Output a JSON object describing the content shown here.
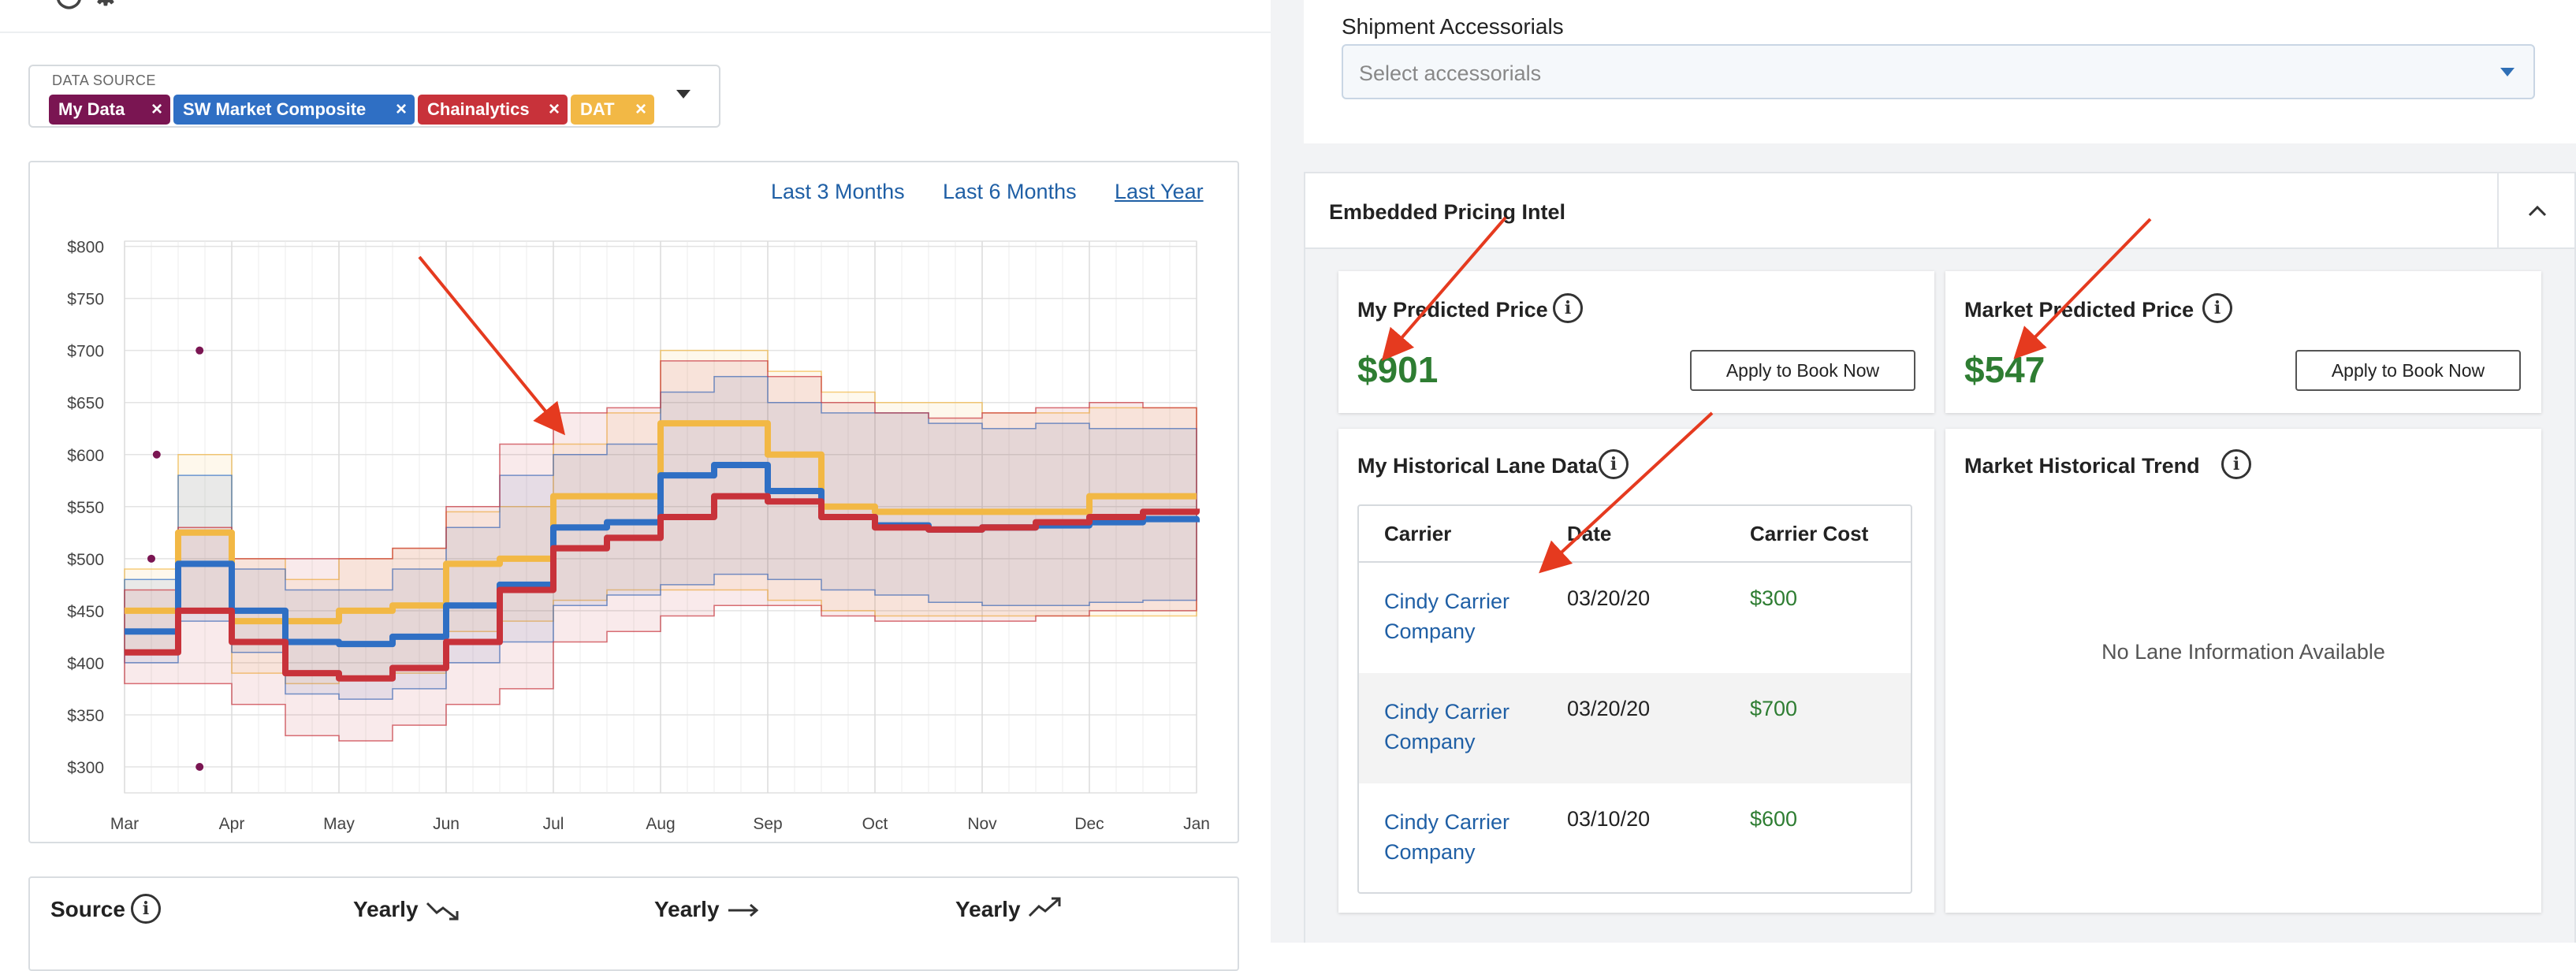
{
  "left": {
    "data_source": {
      "label": "DATA SOURCE",
      "chips": [
        {
          "label": "My Data",
          "remove": "×",
          "color": "#7a1552"
        },
        {
          "label": "SW Market Composite",
          "remove": "×",
          "color": "#2f6fc4"
        },
        {
          "label": "Chainalytics",
          "remove": "×",
          "color": "#c8323a"
        },
        {
          "label": "DAT",
          "remove": "×",
          "color": "#f2b845"
        }
      ]
    },
    "ranges": [
      "Last 3 Months",
      "Last 6 Months",
      "Last Year"
    ],
    "bottom_card": {
      "source_label": "Source",
      "col1": "Yearly",
      "col2": "Yearly",
      "col3": "Yearly"
    }
  },
  "chart_data": {
    "type": "line",
    "y_ticks": [
      "$800",
      "$750",
      "$700",
      "$650",
      "$600",
      "$550",
      "$500",
      "$450",
      "$400",
      "$350",
      "$300"
    ],
    "x_ticks": [
      "Mar",
      "Apr",
      "May",
      "Jun",
      "Jul",
      "Aug",
      "Sep",
      "Oct",
      "Nov",
      "Dec",
      "Jan"
    ],
    "ylim": [
      275,
      805
    ],
    "grid": true,
    "series": [
      {
        "name": "My Data",
        "color": "#7a1552",
        "kind": "points",
        "points": [
          [
            0.7,
            700
          ],
          [
            0.3,
            600
          ],
          [
            0.25,
            500
          ],
          [
            0.7,
            300
          ]
        ]
      },
      {
        "name": "SW Market Composite",
        "color": "#2f6fc4",
        "kind": "band",
        "x": [
          0,
          0.5,
          1,
          1.5,
          2,
          2.5,
          3,
          3.5,
          4,
          4.5,
          5,
          5.5,
          6,
          6.5,
          7,
          7.5,
          8,
          8.5,
          9,
          9.5,
          10
        ],
        "center": [
          430,
          495,
          450,
          420,
          418,
          425,
          455,
          475,
          530,
          535,
          580,
          590,
          565,
          540,
          532,
          528,
          530,
          532,
          535,
          538,
          535
        ],
        "upper": [
          480,
          580,
          490,
          470,
          470,
          490,
          530,
          580,
          600,
          610,
          660,
          675,
          650,
          640,
          640,
          630,
          625,
          630,
          625,
          625,
          620
        ],
        "lower": [
          400,
          440,
          410,
          370,
          365,
          375,
          400,
          420,
          455,
          465,
          475,
          485,
          480,
          470,
          465,
          458,
          455,
          455,
          458,
          460,
          460
        ]
      },
      {
        "name": "Chainalytics",
        "color": "#c8323a",
        "kind": "band",
        "x": [
          0,
          0.5,
          1,
          1.5,
          2,
          2.5,
          3,
          3.5,
          4,
          4.5,
          5,
          5.5,
          6,
          6.5,
          7,
          7.5,
          8,
          8.5,
          9,
          9.5,
          10
        ],
        "center": [
          410,
          450,
          420,
          390,
          385,
          395,
          420,
          470,
          510,
          520,
          540,
          560,
          555,
          540,
          530,
          528,
          530,
          535,
          540,
          545,
          548
        ],
        "upper": [
          470,
          530,
          500,
          500,
          500,
          510,
          550,
          610,
          640,
          645,
          690,
          690,
          675,
          650,
          640,
          635,
          640,
          645,
          650,
          645,
          645
        ],
        "lower": [
          380,
          380,
          360,
          330,
          325,
          340,
          360,
          375,
          420,
          430,
          445,
          455,
          455,
          445,
          440,
          440,
          440,
          445,
          450,
          450,
          450
        ]
      },
      {
        "name": "DAT",
        "color": "#f2b845",
        "kind": "band",
        "x": [
          0,
          0.5,
          1,
          1.5,
          2,
          2.5,
          3,
          3.5,
          4,
          4.5,
          5,
          5.5,
          6,
          6.5,
          7,
          7.5,
          8,
          8.5,
          9,
          9.5,
          10
        ],
        "center": [
          450,
          525,
          440,
          440,
          450,
          455,
          495,
          500,
          560,
          560,
          630,
          630,
          600,
          550,
          545,
          545,
          545,
          545,
          560,
          560,
          560
        ],
        "upper": [
          490,
          600,
          500,
          480,
          500,
          510,
          545,
          550,
          610,
          640,
          700,
          700,
          680,
          660,
          650,
          650,
          640,
          640,
          645,
          645,
          640
        ],
        "lower": [
          410,
          450,
          390,
          380,
          385,
          390,
          430,
          440,
          460,
          470,
          470,
          470,
          460,
          450,
          445,
          445,
          445,
          445,
          445,
          445,
          445
        ]
      }
    ]
  },
  "right": {
    "accessorials": {
      "label": "Shipment Accessorials",
      "placeholder": "Select accessorials"
    },
    "epi_title": "Embedded Pricing Intel",
    "my_price": {
      "title": "My Predicted Price",
      "value": "$901",
      "button": "Apply to Book Now"
    },
    "market_price": {
      "title": "Market Predicted Price",
      "value": "$547",
      "button": "Apply to Book Now"
    },
    "my_history": {
      "title": "My Historical Lane Data",
      "headers": [
        "Carrier",
        "Date",
        "Carrier Cost"
      ],
      "rows": [
        {
          "carrier": "Cindy Carrier Company",
          "date": "03/20/20",
          "cost": "$300"
        },
        {
          "carrier": "Cindy Carrier Company",
          "date": "03/20/20",
          "cost": "$700"
        },
        {
          "carrier": "Cindy Carrier Company",
          "date": "03/10/20",
          "cost": "$600"
        }
      ]
    },
    "market_trend": {
      "title": "Market Historical Trend",
      "empty": "No Lane Information Available"
    }
  },
  "colors": {
    "accent_green": "#2e7d32",
    "link_blue": "#1f5fa5",
    "arrow_red": "#e53a1f"
  }
}
